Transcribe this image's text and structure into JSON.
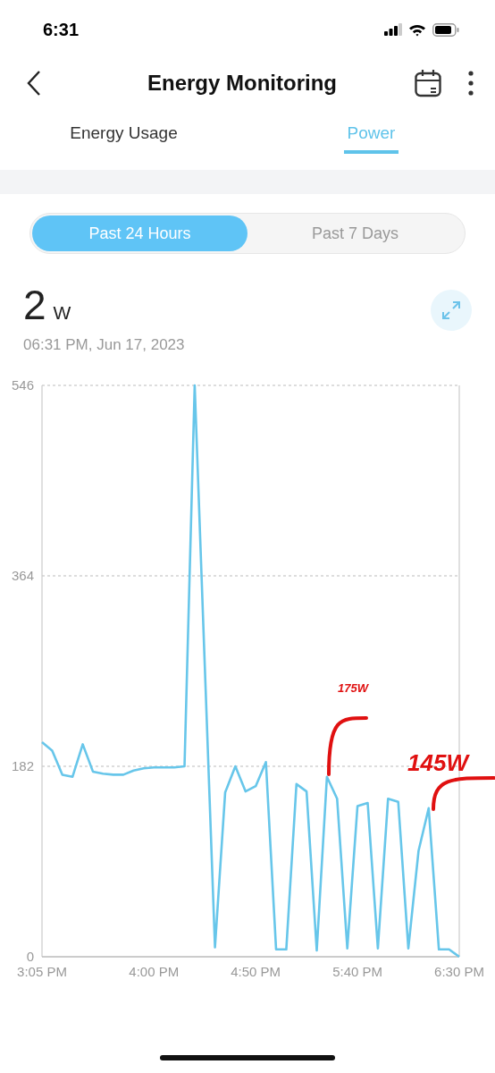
{
  "status_bar": {
    "time": "6:31"
  },
  "header": {
    "title": "Energy Monitoring"
  },
  "tabs": [
    {
      "label": "Energy Usage",
      "selected": false
    },
    {
      "label": "Power",
      "selected": true
    }
  ],
  "range": [
    {
      "label": "Past 24 Hours",
      "selected": true
    },
    {
      "label": "Past 7 Days",
      "selected": false
    }
  ],
  "reading": {
    "value": "2",
    "unit": "W",
    "timestamp": "06:31 PM, Jun 17, 2023"
  },
  "chart_data": {
    "type": "line",
    "categories": [
      "3:05 PM",
      null,
      null,
      null,
      null,
      null,
      null,
      null,
      null,
      null,
      null,
      "4:00 PM",
      null,
      null,
      null,
      null,
      null,
      null,
      null,
      null,
      null,
      "4:50 PM",
      null,
      null,
      null,
      null,
      null,
      null,
      null,
      null,
      null,
      "5:40 PM",
      null,
      null,
      null,
      null,
      null,
      null,
      null,
      null,
      null,
      "6:30 PM"
    ],
    "series": [
      {
        "color": "#67c6ea",
        "values": [
          205,
          197,
          174,
          172,
          203,
          177,
          175,
          174,
          174,
          178,
          180,
          181,
          181,
          181,
          182,
          546,
          278,
          9,
          157,
          182,
          158,
          163,
          186,
          7,
          7,
          165,
          158,
          6,
          172,
          151,
          8,
          144,
          147,
          8,
          151,
          148,
          8,
          101,
          142,
          7,
          7,
          0
        ]
      }
    ],
    "ylim": [
      0,
      546
    ],
    "yticks": [
      0,
      182,
      364,
      546
    ],
    "annotations": [
      "175W",
      "145W"
    ]
  }
}
